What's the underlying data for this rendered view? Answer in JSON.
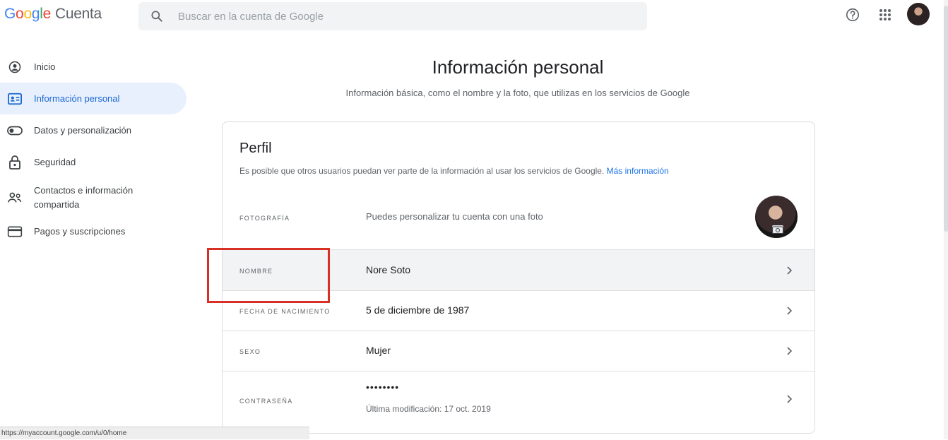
{
  "header": {
    "logo": {
      "letters": [
        "G",
        "o",
        "o",
        "g",
        "l",
        "e"
      ],
      "product": "Cuenta"
    },
    "search": {
      "placeholder": "Buscar en la cuenta de Google",
      "icon": "search-icon"
    },
    "icons": [
      "help-icon",
      "apps-grid-icon",
      "account-avatar"
    ]
  },
  "sidebar": {
    "items": [
      {
        "label": "Inicio",
        "icon": "home-icon"
      },
      {
        "label": "Información personal",
        "icon": "id-card-icon"
      },
      {
        "label": "Datos y personalización",
        "icon": "toggle-icon"
      },
      {
        "label": "Seguridad",
        "icon": "lock-icon"
      },
      {
        "label": "Contactos e información compartida",
        "icon": "people-icon"
      },
      {
        "label": "Pagos y suscripciones",
        "icon": "credit-card-icon"
      }
    ]
  },
  "main": {
    "title": "Información personal",
    "subtitle": "Información básica, como el nombre y la foto, que utilizas en los servicios de Google",
    "profile": {
      "title": "Perfil",
      "description": "Es posible que otros usuarios puedan ver parte de la información al usar los servicios de Google.",
      "more_link": "Más información",
      "rows": [
        {
          "label": "Fotografía",
          "value": "Puedes personalizar tu cuenta con una foto"
        },
        {
          "label": "Nombre",
          "value": "Nore Soto"
        },
        {
          "label": "Fecha de nacimiento",
          "value": "5 de diciembre de 1987"
        },
        {
          "label": "Sexo",
          "value": "Mujer"
        },
        {
          "label": "Contraseña",
          "value": "••••••••",
          "sub": "Última modificación: 17 oct. 2019"
        }
      ]
    }
  },
  "status_bar": {
    "url": "https://myaccount.google.com/u/0/home"
  },
  "colors": {
    "accent": "#1a73e8",
    "active_bg": "#e8f0fe",
    "highlight": "#d93025"
  }
}
